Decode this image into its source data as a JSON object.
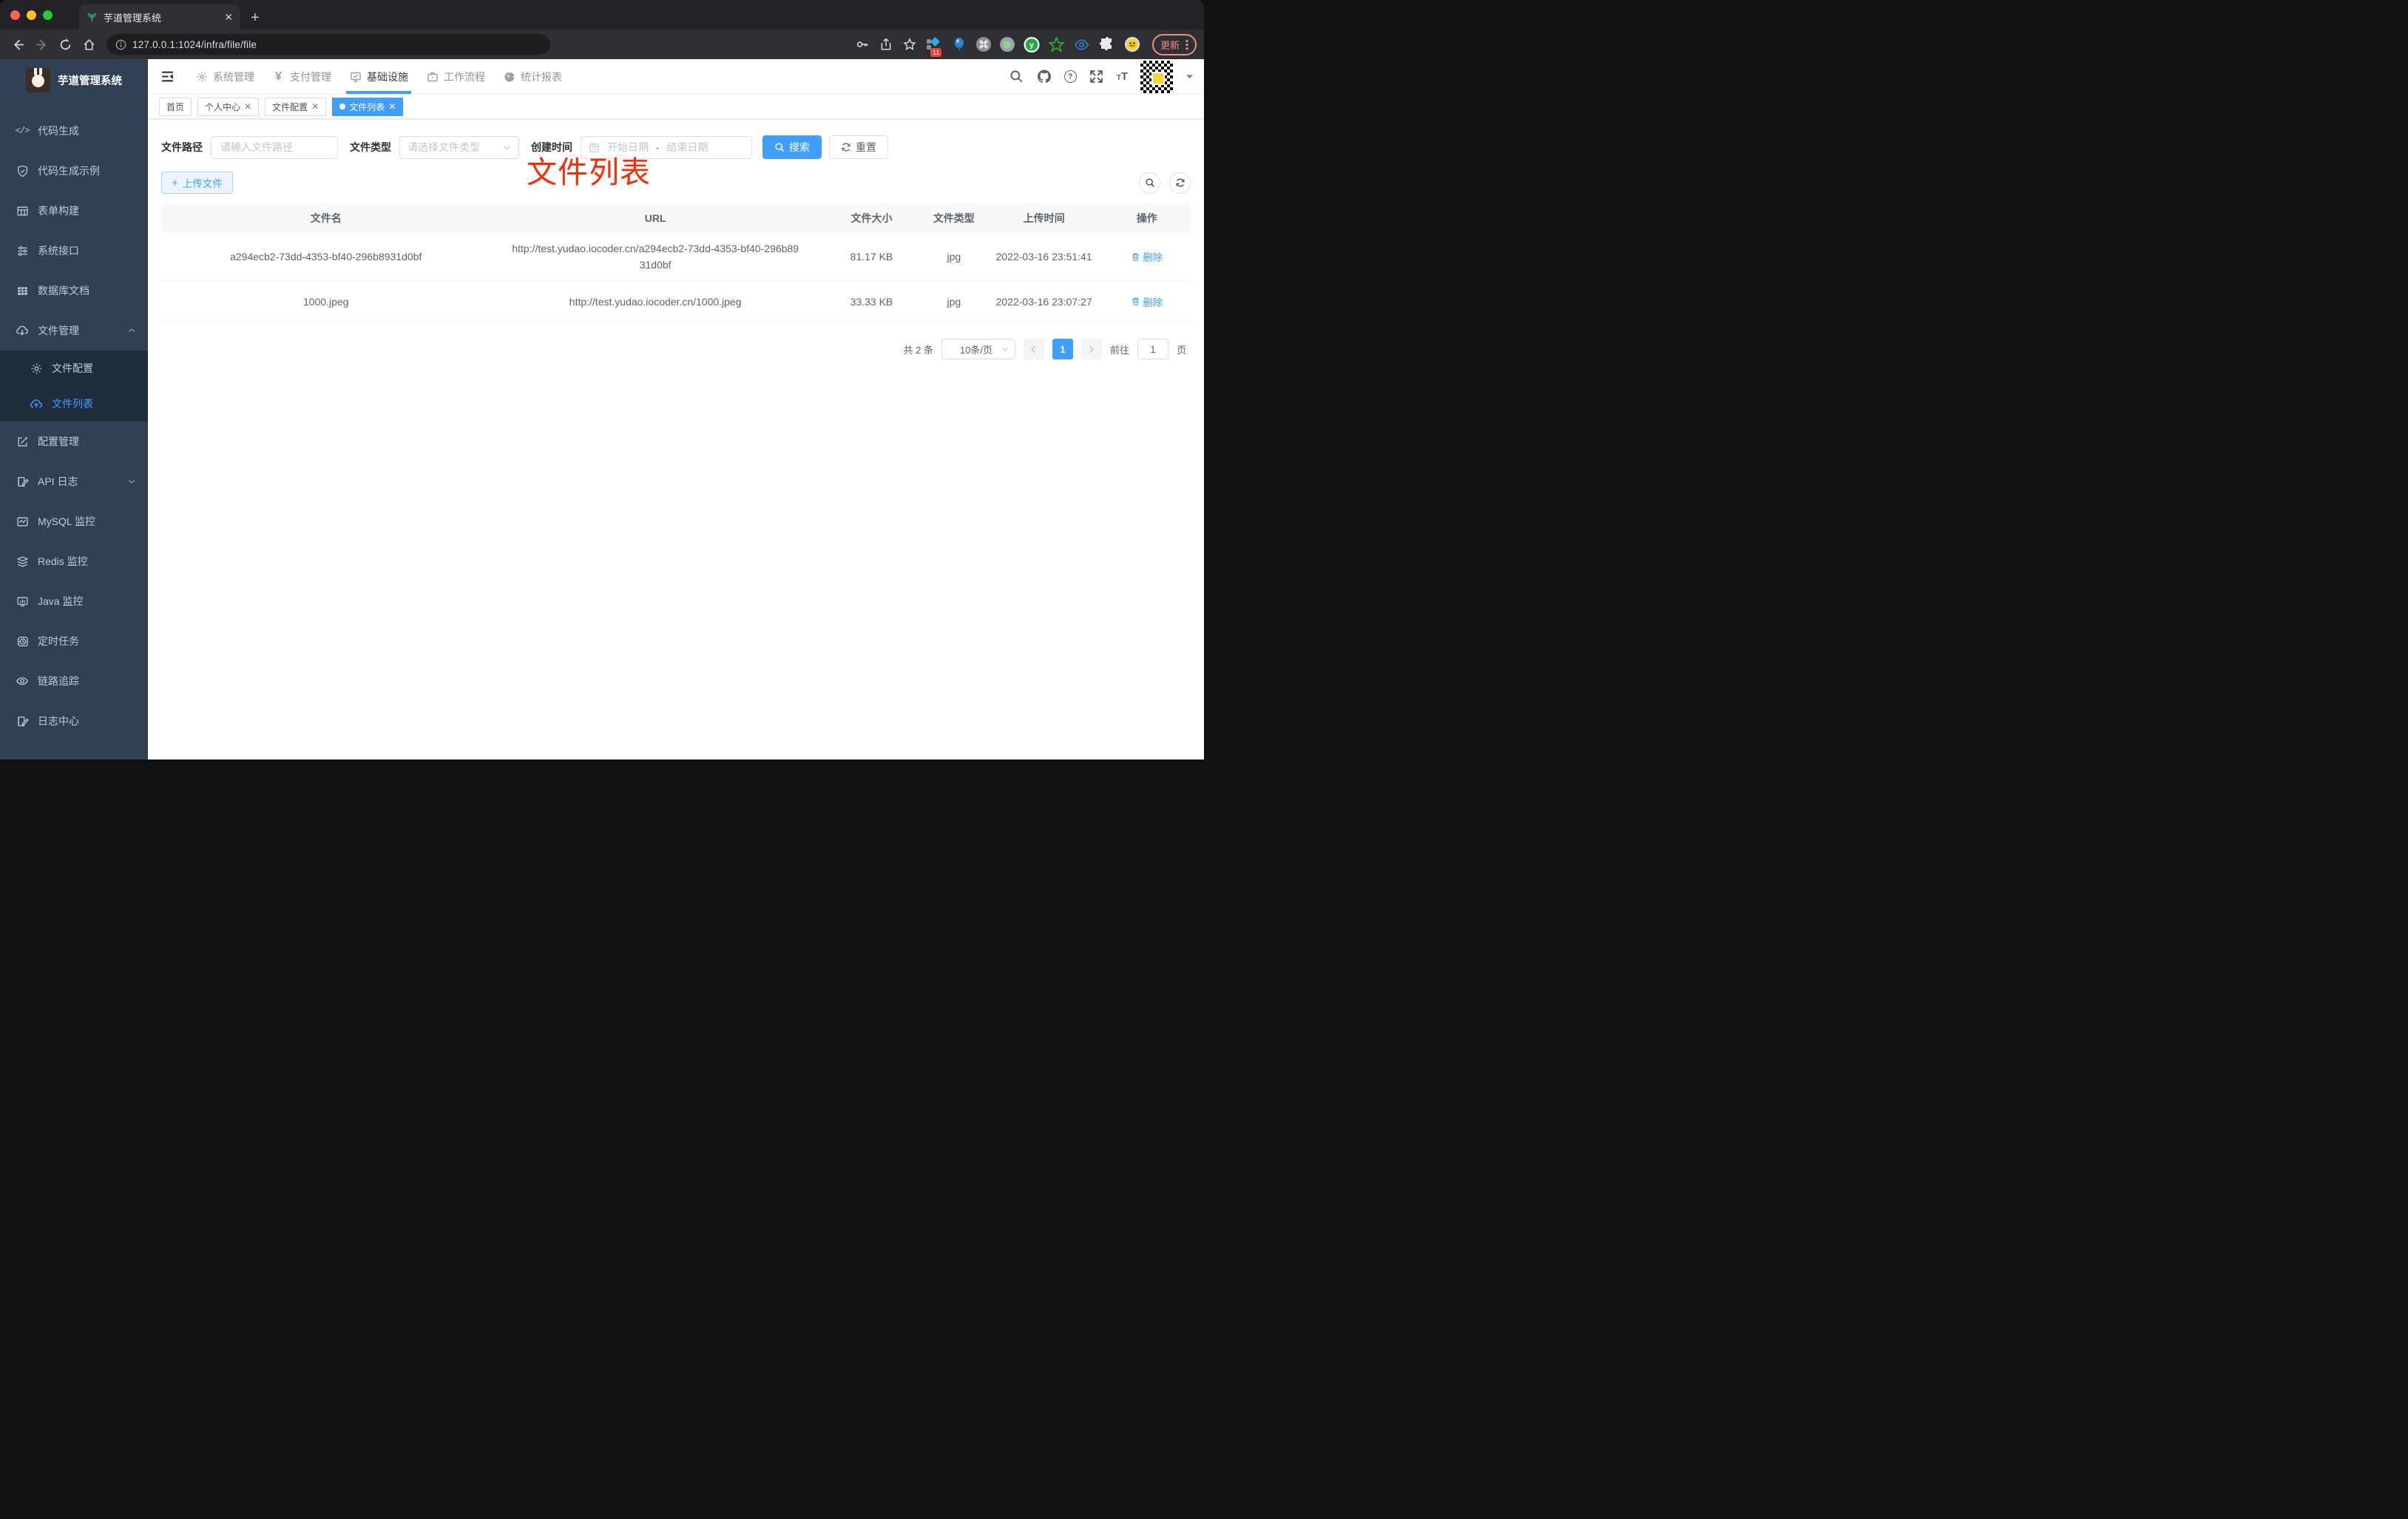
{
  "browser": {
    "tab_title": "芋道管理系统",
    "url": "127.0.0.1:1024/infra/file/file",
    "update_label": "更新",
    "ext_badge": "11",
    "traffic_colors": {
      "close": "#ff5f57",
      "minimize": "#febc2e",
      "zoom": "#2ac840"
    }
  },
  "header": {
    "menus": [
      {
        "label": "系统管理",
        "icon": "gear-icon"
      },
      {
        "label": "支付管理",
        "icon": "yen-icon"
      },
      {
        "label": "基础设施",
        "icon": "monitor-check-icon",
        "active": true
      },
      {
        "label": "工作流程",
        "icon": "briefcase-icon"
      },
      {
        "label": "统计报表",
        "icon": "dashboard-icon"
      }
    ],
    "right_icons": [
      "search-icon",
      "github-icon",
      "help-icon",
      "fullscreen-icon",
      "font-size-icon",
      "qr-avatar",
      "chevron-down-icon"
    ]
  },
  "sidebar": {
    "title": "芋道管理系统",
    "items": [
      {
        "label": "代码生成",
        "icon": "code-icon"
      },
      {
        "label": "代码生成示例",
        "icon": "shield-check-icon"
      },
      {
        "label": "表单构建",
        "icon": "form-icon"
      },
      {
        "label": "系统接口",
        "icon": "sliders-icon"
      },
      {
        "label": "数据库文档",
        "icon": "database-table-icon"
      },
      {
        "label": "文件管理",
        "icon": "cloud-download-icon",
        "expanded": true
      },
      {
        "label": "文件配置",
        "icon": "gear-icon",
        "sub": true
      },
      {
        "label": "文件列表",
        "icon": "cloud-upload-icon",
        "sub": true,
        "active": true
      },
      {
        "label": "配置管理",
        "icon": "edit-square-icon"
      },
      {
        "label": "API 日志",
        "icon": "doc-edit-icon",
        "collapsed": true
      },
      {
        "label": "MySQL 监控",
        "icon": "chart-line-icon"
      },
      {
        "label": "Redis 监控",
        "icon": "layers-icon"
      },
      {
        "label": "Java 监控",
        "icon": "monitor-bars-icon"
      },
      {
        "label": "定时任务",
        "icon": "timer-icon"
      },
      {
        "label": "链路追踪",
        "icon": "eye-icon"
      },
      {
        "label": "日志中心",
        "icon": "log-edit-icon"
      }
    ]
  },
  "tags": [
    {
      "label": "首页",
      "closable": false,
      "active": false
    },
    {
      "label": "个人中心",
      "closable": true,
      "active": false
    },
    {
      "label": "文件配置",
      "closable": true,
      "active": false
    },
    {
      "label": "文件列表",
      "closable": true,
      "active": true
    }
  ],
  "annotation": {
    "text": "文件列表",
    "color": "#f62d0a"
  },
  "filters": {
    "path_label": "文件路径",
    "path_placeholder": "请输入文件路径",
    "type_label": "文件类型",
    "type_placeholder": "请选择文件类型",
    "date_label": "创建时间",
    "date_start": "开始日期",
    "date_separator": "-",
    "date_end": "结束日期",
    "search_label": "搜索",
    "reset_label": "重置"
  },
  "toolbar": {
    "upload_label": "上传文件",
    "plus": "+"
  },
  "table": {
    "columns": [
      "文件名",
      "URL",
      "文件大小",
      "文件类型",
      "上传时间",
      "操作"
    ],
    "rows": [
      {
        "name": "a294ecb2-73dd-4353-bf40-296b8931d0bf",
        "url": "http://test.yudao.iocoder.cn/a294ecb2-73dd-4353-bf40-296b8931d0bf",
        "size": "81.17 KB",
        "type": "jpg",
        "time": "2022-03-16 23:51:41",
        "action": "删除"
      },
      {
        "name": "1000.jpeg",
        "url": "http://test.yudao.iocoder.cn/1000.jpeg",
        "size": "33.33 KB",
        "type": "jpg",
        "time": "2022-03-16 23:07:27",
        "action": "删除"
      }
    ]
  },
  "pagination": {
    "total_text": "共 2 条",
    "page_size": "10条/页",
    "current_page": "1",
    "goto_label": "前往",
    "goto_value": "1",
    "page_unit": "页"
  },
  "accent_colors": {
    "primary": "#409eff",
    "sidebar_bg": "#304156",
    "submenu_bg": "#1f2d3d",
    "update_pill": "#f28b82"
  }
}
